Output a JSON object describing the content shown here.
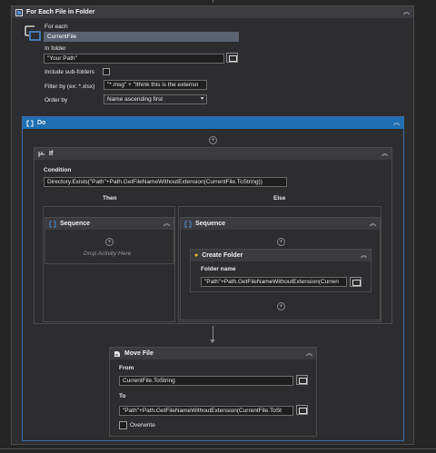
{
  "foreach": {
    "title": "For Each File in Folder",
    "for_each_label": "For each",
    "for_each_value": "CurrentFile",
    "in_folder_label": "In folder",
    "in_folder_value": "\"Your Path\"",
    "include_subfolders_label": "Include sub-folders",
    "filter_label": "Filter by (ex: *.xlsx)",
    "filter_value": "\"*.msg\" + \"Ithink this is the extensn",
    "order_label": "Order by",
    "order_value": "Name ascending first"
  },
  "do": {
    "title": "Do"
  },
  "if_block": {
    "title": "If",
    "condition_label": "Condition",
    "condition_value": "Directory.Exists(\"Path\"+Path.GetFileNameWithoutExtension(CurrentFile.ToString))",
    "then_label": "Then",
    "else_label": "Else"
  },
  "then_sequence": {
    "title": "Sequence",
    "drop_hint": "Drop Activity Here"
  },
  "else_sequence": {
    "title": "Sequence"
  },
  "create_folder": {
    "title": "Create Folder",
    "folder_name_label": "Folder name",
    "folder_name_value": "\"Path\"+Path.GetFileNameWithoutExtension(Curren"
  },
  "move_file": {
    "title": "Move File",
    "from_label": "From",
    "from_value": "CurrentFile.ToString",
    "to_label": "To",
    "to_value": "\"Path\"+Path.GetFileNameWithoutExtension(CurrentFile.ToSt",
    "overwrite_label": "Overwrite"
  },
  "colors": {
    "accent": "#1f6fb2",
    "background": "#252526",
    "panel": "#2d2d30"
  }
}
